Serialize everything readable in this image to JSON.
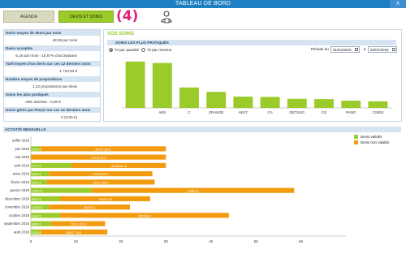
{
  "window": {
    "title": "TABLEAU DE BORD",
    "close_label": "X"
  },
  "tabs": {
    "agenda": "AGENDA",
    "devis": "DEVIS ET SOINS"
  },
  "step_label": "(4)",
  "stats": [
    {
      "label": "Devis moyen de devis par mois",
      "value": "48,08 par mois"
    },
    {
      "label": "Devis acceptés",
      "value": "6,16 par mois - 15,57% d'acceptation"
    },
    {
      "label": "Tarif moyen d'un devis sur ces 12 derniers mois",
      "value": "1 723,83 €"
    },
    {
      "label": "Nombre moyen de propositions",
      "value": "1,22 propositions par devis"
    },
    {
      "label": "Soins les plus pratiqués",
      "value": "ABS    2910/an - 0,00 €"
    },
    {
      "label": "Devis gérés par Fee@i sur ces 12 derniers mois",
      "value": "0 (0,00 €)"
    }
  ],
  "vos_soins": {
    "title": "VOS SOINS",
    "band": "SOINS LES PLUS PRATIQUÉS",
    "radio_quantite": "Tri par quantité",
    "radio_revenus": "Tri par revenus",
    "periode_label": "Période du",
    "date_from": "01/01/2019",
    "date_sep": "à",
    "date_to": "02/07/2019"
  },
  "activite_title": "ACTIVITÉ MENSUELLE",
  "colors": {
    "green": "#9acb2a",
    "orange": "#f29b0e",
    "title_blue": "#1e7fc2",
    "band_blue": "#d6e4f1"
  },
  "chart_data": [
    {
      "type": "bar",
      "categories": [
        "",
        "ABS",
        "C",
        "ZFANOD",
        "AEXT",
        "CA",
        "DETSSG",
        "CG",
        "PANO",
        "CS053"
      ],
      "values": [
        2950,
        2860,
        1300,
        1020,
        720,
        700,
        580,
        560,
        460,
        420
      ],
      "ylim": [
        0,
        3200
      ],
      "color": "#9acb2a"
    },
    {
      "type": "bar",
      "orientation": "horizontal",
      "stacked": true,
      "categories": [
        "juillet 2019",
        "juin 2019",
        "mai 2019",
        "avril 2019",
        "mars 2019",
        "février 2019",
        "janvier 2019",
        "décembre 2018",
        "novembre 2018",
        "octobre 2018",
        "septembre 2018",
        "août 2018"
      ],
      "xlim": [
        0,
        70
      ],
      "xticks": [
        0,
        10,
        20,
        30,
        40,
        50,
        60
      ],
      "legend": "top-right",
      "series": [
        {
          "name": "Devis validés",
          "color": "#9acb2a",
          "values": [
            0,
            2,
            0,
            9,
            4,
            3.5,
            13.5,
            6.5,
            4,
            6.5,
            4.5,
            2
          ],
          "labels": [
            "",
            "1406 €",
            "",
            "5770 €",
            "3250 €",
            "3250 €",
            "17940 €",
            "8625 €",
            "12845 €",
            "6740 €",
            "4850 €",
            "1330 €"
          ]
        },
        {
          "name": "Devis non validés",
          "color": "#f29b0e",
          "values": [
            0,
            28,
            30,
            21,
            23,
            24,
            45,
            20,
            18,
            37.5,
            12,
            15
          ],
          "labels": [
            "",
            "38741,96 €",
            "47393,26 €",
            "45285,64 €",
            "69055,35 €",
            "64127,56 €",
            "92880 €",
            "79083,6 €",
            "55200 €",
            "135158 €",
            "22071,35 €",
            "28057,78 €"
          ]
        }
      ]
    }
  ]
}
